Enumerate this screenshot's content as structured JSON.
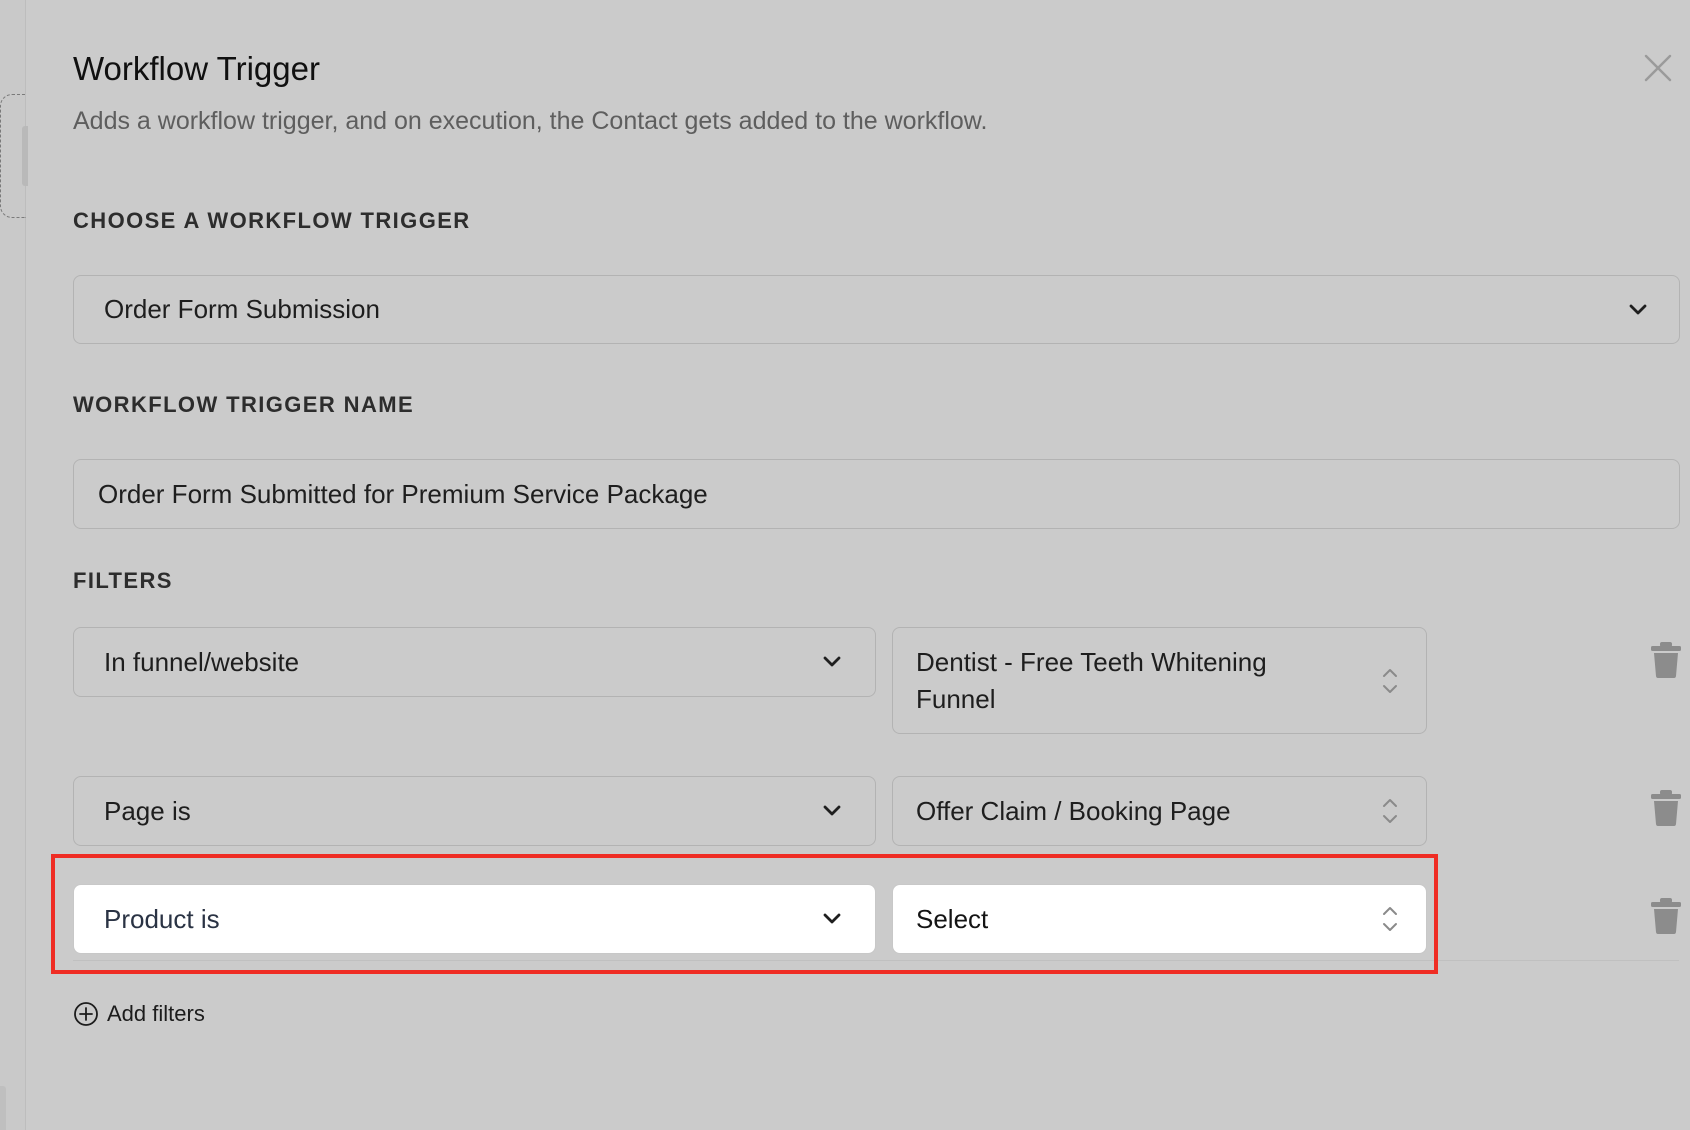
{
  "modal": {
    "title": "Workflow Trigger",
    "subtitle": "Adds a workflow trigger, and on execution, the Contact gets added to the workflow."
  },
  "sections": {
    "trigger_label": "CHOOSE A WORKFLOW TRIGGER",
    "name_label": "WORKFLOW TRIGGER NAME",
    "filters_label": "FILTERS"
  },
  "trigger_select": {
    "value": "Order Form Submission"
  },
  "trigger_name": {
    "value": "Order Form Submitted for Premium Service Package"
  },
  "filters": [
    {
      "field": "In funnel/website",
      "value_line1": "Dentist - Free Teeth Whitening",
      "value_line2": "Funnel"
    },
    {
      "field": "Page is",
      "value": "Offer Claim / Booking Page"
    },
    {
      "field": "Product is",
      "value": "Select"
    }
  ],
  "add_filters_label": "Add filters",
  "icons": {
    "close": "close-icon",
    "dropdown": "chevron-down-icon",
    "stepper": "chevron-up-down-icon",
    "delete": "trash-icon",
    "add": "plus-circle-icon"
  },
  "colors": {
    "overlay_background": "#cbcbcb",
    "highlight": "#ef2d24",
    "active_field": "#ffffff"
  }
}
